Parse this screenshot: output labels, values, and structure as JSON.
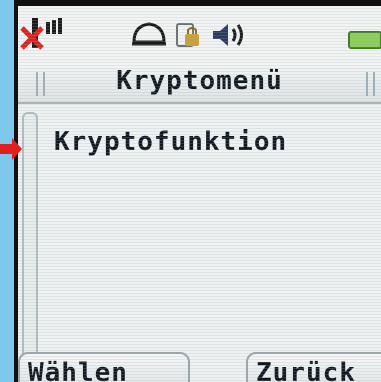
{
  "header": {
    "title": "Kryptomenü"
  },
  "list": {
    "items": [
      {
        "label": "Kryptofunktion"
      }
    ]
  },
  "softkeys": {
    "left_label": "Wählen",
    "right_label": "Zurück"
  },
  "status_bar": {
    "icons": [
      "signal-icon",
      "ring-profile-icon",
      "keypad-lock-icon",
      "speaker-volume-icon",
      "battery-icon"
    ]
  },
  "colors": {
    "background": "#7ec8ee",
    "screen": "#eef2f2",
    "text": "#101820",
    "pointer": "#e0201c"
  }
}
